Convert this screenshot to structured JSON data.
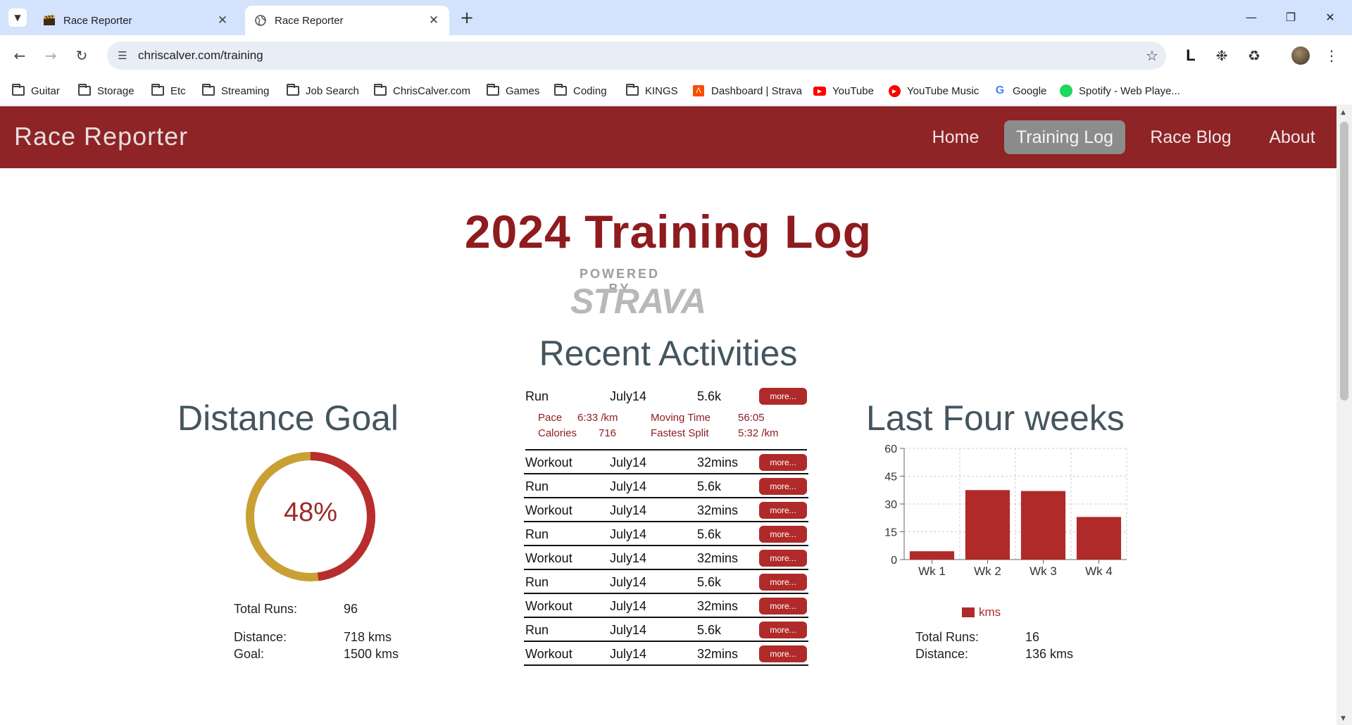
{
  "browser": {
    "tabs": [
      {
        "title": "Race Reporter",
        "icon": "clapperboard-icon"
      },
      {
        "title": "Race Reporter",
        "icon": "globe-icon",
        "active": true
      }
    ],
    "url": "chriscalver.com/training",
    "bookmarks": [
      {
        "label": "Guitar",
        "icon": "folder-icon"
      },
      {
        "label": "Storage",
        "icon": "folder-icon"
      },
      {
        "label": "Etc",
        "icon": "folder-icon"
      },
      {
        "label": "Streaming",
        "icon": "folder-icon"
      },
      {
        "label": "Job Search",
        "icon": "folder-icon"
      },
      {
        "label": "ChrisCalver.com",
        "icon": "folder-icon"
      },
      {
        "label": "Games",
        "icon": "folder-icon"
      },
      {
        "label": "Coding",
        "icon": "folder-icon"
      },
      {
        "label": "KINGS",
        "icon": "folder-icon"
      },
      {
        "label": "Dashboard | Strava",
        "icon": "strava-icon"
      },
      {
        "label": "YouTube",
        "icon": "youtube-icon"
      },
      {
        "label": "YouTube Music",
        "icon": "youtube-music-icon"
      },
      {
        "label": "Google",
        "icon": "google-icon"
      },
      {
        "label": "Spotify - Web Playe...",
        "icon": "spotify-icon"
      }
    ],
    "profile_letter": "L"
  },
  "site": {
    "brand": "Race Reporter",
    "nav": [
      {
        "label": "Home"
      },
      {
        "label": "Training Log",
        "active": true
      },
      {
        "label": "Race Blog"
      },
      {
        "label": "About"
      }
    ],
    "accent_color": "#8e2426"
  },
  "main": {
    "title": "2024 Training Log",
    "powered_by": "POWERED BY",
    "strava": "STRAVA",
    "recent_title": "Recent Activities",
    "distance_goal": {
      "title": "Distance Goal",
      "percent": 48,
      "percent_label": "48%",
      "total_runs_label": "Total Runs:",
      "total_runs": "96",
      "distance_label": "Distance:",
      "distance": "718 kms",
      "goal_label": "Goal:",
      "goal": "1500 kms",
      "colors": {
        "done": "#b82d2d",
        "remaining": "#c9a034"
      }
    },
    "activities": [
      {
        "type": "Run",
        "date": "July14",
        "dist": "5.6k",
        "more": "more..."
      },
      {
        "type": "Workout",
        "date": "July14",
        "dist": "32mins",
        "more": "more..."
      },
      {
        "type": "Run",
        "date": "July14",
        "dist": "5.6k",
        "more": "more..."
      },
      {
        "type": "Workout",
        "date": "July14",
        "dist": "32mins",
        "more": "more..."
      },
      {
        "type": "Run",
        "date": "July14",
        "dist": "5.6k",
        "more": "more..."
      },
      {
        "type": "Workout",
        "date": "July14",
        "dist": "32mins",
        "more": "more..."
      },
      {
        "type": "Run",
        "date": "July14",
        "dist": "5.6k",
        "more": "more..."
      },
      {
        "type": "Workout",
        "date": "July14",
        "dist": "32mins",
        "more": "more..."
      },
      {
        "type": "Run",
        "date": "July14",
        "dist": "5.6k",
        "more": "more..."
      },
      {
        "type": "Workout",
        "date": "July14",
        "dist": "32mins",
        "more": "more..."
      }
    ],
    "activity_detail": {
      "pace_label": "Pace",
      "pace": "6:33 /km",
      "moving_label": "Moving Time",
      "moving": "56:05",
      "calories_label": "Calories",
      "calories": "716",
      "split_label": "Fastest Split",
      "split": "5:32 /km"
    },
    "last_four": {
      "title": "Last Four weeks",
      "total_runs_label": "Total Runs:",
      "total_runs": "16",
      "distance_label": "Distance:",
      "distance": "136 kms"
    }
  },
  "chart_data": {
    "type": "bar",
    "categories": [
      "Wk 1",
      "Wk 2",
      "Wk 3",
      "Wk 4"
    ],
    "series": [
      {
        "name": "kms",
        "values": [
          4.5,
          37.5,
          37,
          23
        ],
        "color": "#b02a2a"
      }
    ],
    "ylim": [
      0,
      60
    ],
    "yticks": [
      0,
      15,
      30,
      45,
      60
    ],
    "grid": true,
    "legend": "bottom"
  }
}
